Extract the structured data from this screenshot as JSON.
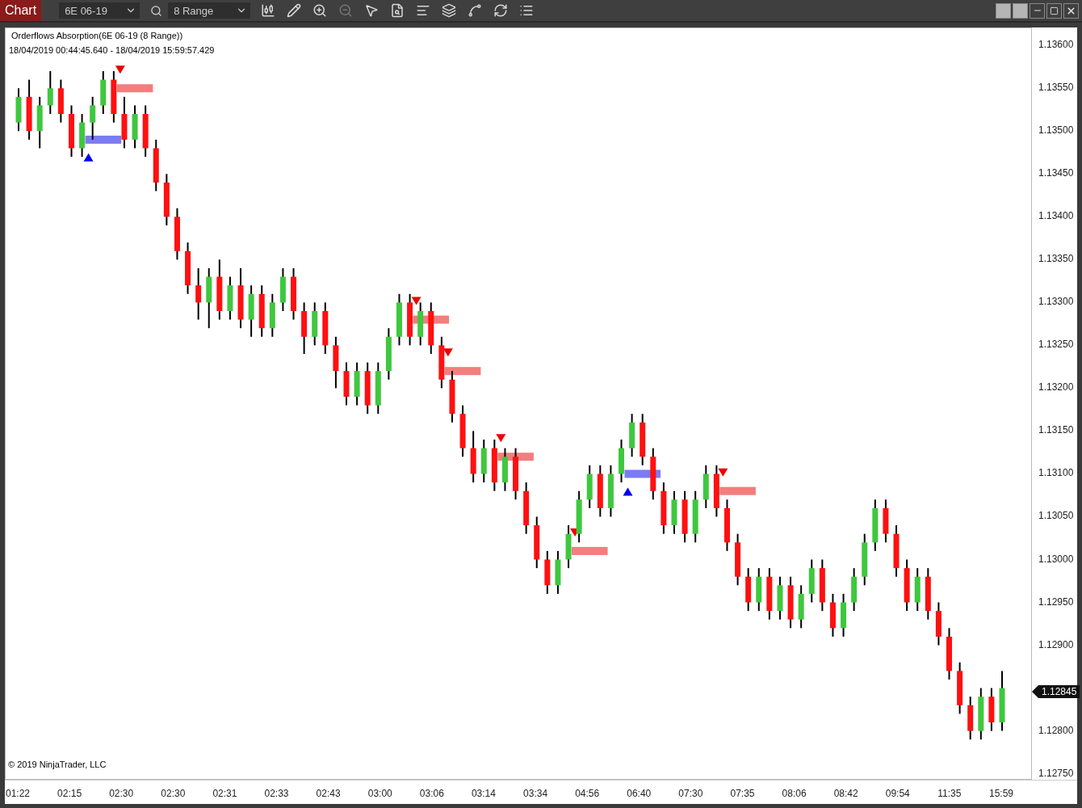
{
  "toolbar": {
    "title": "Chart",
    "instrument": "6E 06-19",
    "period": "8 Range"
  },
  "chart": {
    "title": "Orderflows Absorption(6E 06-19 (8 Range))",
    "date_range": "18/04/2019 00:44:45.640 - 18/04/2019 15:59:57.429",
    "copyright": "© 2019 NinjaTrader, LLC",
    "last_price": "1.12845",
    "x_axis": [
      "01:22",
      "02:15",
      "02:30",
      "02:30",
      "02:31",
      "02:33",
      "02:43",
      "03:00",
      "03:06",
      "03:14",
      "03:34",
      "04:56",
      "06:40",
      "07:30",
      "07:35",
      "08:06",
      "08:42",
      "09:54",
      "11:35",
      "15:59"
    ],
    "signals": [
      {
        "kind": "buy"
      },
      {
        "kind": "sell"
      },
      {
        "kind": "sell"
      },
      {
        "kind": "sell"
      },
      {
        "kind": "sell"
      },
      {
        "kind": "sell"
      },
      {
        "kind": "buy"
      },
      {
        "kind": "sell"
      }
    ],
    "chart_data": {
      "type": "candlestick",
      "ylim": [
        1.12744,
        1.1362
      ],
      "ohlc": [
        [
          1.1351,
          1.1355,
          1.135,
          1.1354
        ],
        [
          1.1354,
          1.1356,
          1.1349,
          1.135
        ],
        [
          1.135,
          1.1354,
          1.1348,
          1.1353
        ],
        [
          1.1353,
          1.1357,
          1.1352,
          1.1355
        ],
        [
          1.1355,
          1.1356,
          1.1351,
          1.1352
        ],
        [
          1.1352,
          1.1353,
          1.1347,
          1.1348
        ],
        [
          1.1348,
          1.1352,
          1.1347,
          1.1351
        ],
        [
          1.1351,
          1.1354,
          1.1349,
          1.1353
        ],
        [
          1.1353,
          1.1357,
          1.1352,
          1.1356
        ],
        [
          1.1356,
          1.1357,
          1.1351,
          1.1352
        ],
        [
          1.1352,
          1.1354,
          1.1348,
          1.1349
        ],
        [
          1.1349,
          1.1353,
          1.1348,
          1.1352
        ],
        [
          1.1352,
          1.1353,
          1.1347,
          1.1348
        ],
        [
          1.1348,
          1.1349,
          1.1343,
          1.1344
        ],
        [
          1.1344,
          1.1345,
          1.1339,
          1.134
        ],
        [
          1.134,
          1.1341,
          1.1335,
          1.1336
        ],
        [
          1.1336,
          1.1337,
          1.1331,
          1.1332
        ],
        [
          1.1332,
          1.1334,
          1.1328,
          1.133
        ],
        [
          1.133,
          1.1334,
          1.1327,
          1.1333
        ],
        [
          1.1333,
          1.1335,
          1.1328,
          1.1329
        ],
        [
          1.1329,
          1.1333,
          1.1328,
          1.1332
        ],
        [
          1.1332,
          1.1334,
          1.1327,
          1.1328
        ],
        [
          1.1328,
          1.1332,
          1.1326,
          1.1331
        ],
        [
          1.1331,
          1.1332,
          1.1326,
          1.1327
        ],
        [
          1.1327,
          1.1331,
          1.1326,
          1.133
        ],
        [
          1.133,
          1.1334,
          1.1329,
          1.1333
        ],
        [
          1.1333,
          1.1334,
          1.1328,
          1.1329
        ],
        [
          1.1329,
          1.133,
          1.1324,
          1.1326
        ],
        [
          1.1326,
          1.133,
          1.1325,
          1.1329
        ],
        [
          1.1329,
          1.133,
          1.1324,
          1.1325
        ],
        [
          1.1325,
          1.1326,
          1.132,
          1.1322
        ],
        [
          1.1322,
          1.1323,
          1.1318,
          1.1319
        ],
        [
          1.1319,
          1.1323,
          1.1318,
          1.1322
        ],
        [
          1.1322,
          1.1323,
          1.1317,
          1.1318
        ],
        [
          1.1318,
          1.1323,
          1.1317,
          1.1322
        ],
        [
          1.1322,
          1.1327,
          1.1321,
          1.1326
        ],
        [
          1.1326,
          1.1331,
          1.1325,
          1.133
        ],
        [
          1.133,
          1.1331,
          1.1325,
          1.1326
        ],
        [
          1.1326,
          1.133,
          1.1325,
          1.1329
        ],
        [
          1.1329,
          1.133,
          1.1324,
          1.1325
        ],
        [
          1.1325,
          1.1326,
          1.132,
          1.1321
        ],
        [
          1.1321,
          1.1322,
          1.1316,
          1.1317
        ],
        [
          1.1317,
          1.1318,
          1.1312,
          1.1313
        ],
        [
          1.1313,
          1.1315,
          1.1309,
          1.131
        ],
        [
          1.131,
          1.1314,
          1.1309,
          1.1313
        ],
        [
          1.1313,
          1.1314,
          1.1308,
          1.1309
        ],
        [
          1.1309,
          1.1313,
          1.1308,
          1.1312
        ],
        [
          1.1312,
          1.1313,
          1.1307,
          1.1308
        ],
        [
          1.1308,
          1.1309,
          1.1303,
          1.1304
        ],
        [
          1.1304,
          1.1305,
          1.1299,
          1.13
        ],
        [
          1.13,
          1.1301,
          1.1296,
          1.1297
        ],
        [
          1.1297,
          1.1301,
          1.1296,
          1.13
        ],
        [
          1.13,
          1.1304,
          1.1299,
          1.1303
        ],
        [
          1.1303,
          1.1308,
          1.1302,
          1.1307
        ],
        [
          1.1307,
          1.1311,
          1.1306,
          1.131
        ],
        [
          1.131,
          1.1311,
          1.1305,
          1.1306
        ],
        [
          1.1306,
          1.1311,
          1.1305,
          1.131
        ],
        [
          1.131,
          1.1314,
          1.1309,
          1.1313
        ],
        [
          1.1313,
          1.1317,
          1.1312,
          1.1316
        ],
        [
          1.1316,
          1.1317,
          1.1311,
          1.1312
        ],
        [
          1.1312,
          1.1313,
          1.1307,
          1.1308
        ],
        [
          1.1308,
          1.1309,
          1.1303,
          1.1304
        ],
        [
          1.1304,
          1.1308,
          1.1303,
          1.1307
        ],
        [
          1.1307,
          1.1308,
          1.1302,
          1.1303
        ],
        [
          1.1303,
          1.1308,
          1.1302,
          1.1307
        ],
        [
          1.1307,
          1.1311,
          1.1306,
          1.131
        ],
        [
          1.131,
          1.1311,
          1.1305,
          1.1306
        ],
        [
          1.1306,
          1.1307,
          1.1301,
          1.1302
        ],
        [
          1.1302,
          1.1303,
          1.1297,
          1.1298
        ],
        [
          1.1298,
          1.1299,
          1.1294,
          1.1295
        ],
        [
          1.1295,
          1.1299,
          1.1294,
          1.1298
        ],
        [
          1.1298,
          1.1299,
          1.1293,
          1.1294
        ],
        [
          1.1294,
          1.1298,
          1.1293,
          1.1297
        ],
        [
          1.1297,
          1.1298,
          1.1292,
          1.1293
        ],
        [
          1.1293,
          1.1297,
          1.1292,
          1.1296
        ],
        [
          1.1296,
          1.13,
          1.1295,
          1.1299
        ],
        [
          1.1299,
          1.13,
          1.1294,
          1.1295
        ],
        [
          1.1295,
          1.1296,
          1.1291,
          1.1292
        ],
        [
          1.1292,
          1.1296,
          1.1291,
          1.1295
        ],
        [
          1.1295,
          1.1299,
          1.1294,
          1.1298
        ],
        [
          1.1298,
          1.1303,
          1.1297,
          1.1302
        ],
        [
          1.1302,
          1.1307,
          1.1301,
          1.1306
        ],
        [
          1.1306,
          1.1307,
          1.1302,
          1.1303
        ],
        [
          1.1303,
          1.1304,
          1.1298,
          1.1299
        ],
        [
          1.1299,
          1.13,
          1.1294,
          1.1295
        ],
        [
          1.1295,
          1.1299,
          1.1294,
          1.1298
        ],
        [
          1.1298,
          1.1299,
          1.1293,
          1.1294
        ],
        [
          1.1294,
          1.1295,
          1.129,
          1.1291
        ],
        [
          1.1291,
          1.1292,
          1.1286,
          1.1287
        ],
        [
          1.1287,
          1.1288,
          1.1282,
          1.1283
        ],
        [
          1.1283,
          1.1284,
          1.1279,
          1.128
        ],
        [
          1.128,
          1.1285,
          1.1279,
          1.1284
        ],
        [
          1.1284,
          1.1285,
          1.128,
          1.1281
        ],
        [
          1.1281,
          1.1287,
          1.128,
          1.1285
        ]
      ],
      "yticks": [
        {
          "value": 1.136,
          "label": "1.13600"
        },
        {
          "value": 1.1355,
          "label": "1.13550"
        },
        {
          "value": 1.135,
          "label": "1.13500"
        },
        {
          "value": 1.1345,
          "label": "1.13450"
        },
        {
          "value": 1.134,
          "label": "1.13400"
        },
        {
          "value": 1.1335,
          "label": "1.13350"
        },
        {
          "value": 1.133,
          "label": "1.13300"
        },
        {
          "value": 1.1325,
          "label": "1.13250"
        },
        {
          "value": 1.132,
          "label": "1.13200"
        },
        {
          "value": 1.1315,
          "label": "1.13150"
        },
        {
          "value": 1.131,
          "label": "1.13100"
        },
        {
          "value": 1.1305,
          "label": "1.13050"
        },
        {
          "value": 1.13,
          "label": "1.13000"
        },
        {
          "value": 1.1295,
          "label": "1.12950"
        },
        {
          "value": 1.129,
          "label": "1.12900"
        },
        {
          "value": 1.128,
          "label": "1.12800"
        },
        {
          "value": 1.1275,
          "label": "1.12750"
        }
      ]
    }
  }
}
